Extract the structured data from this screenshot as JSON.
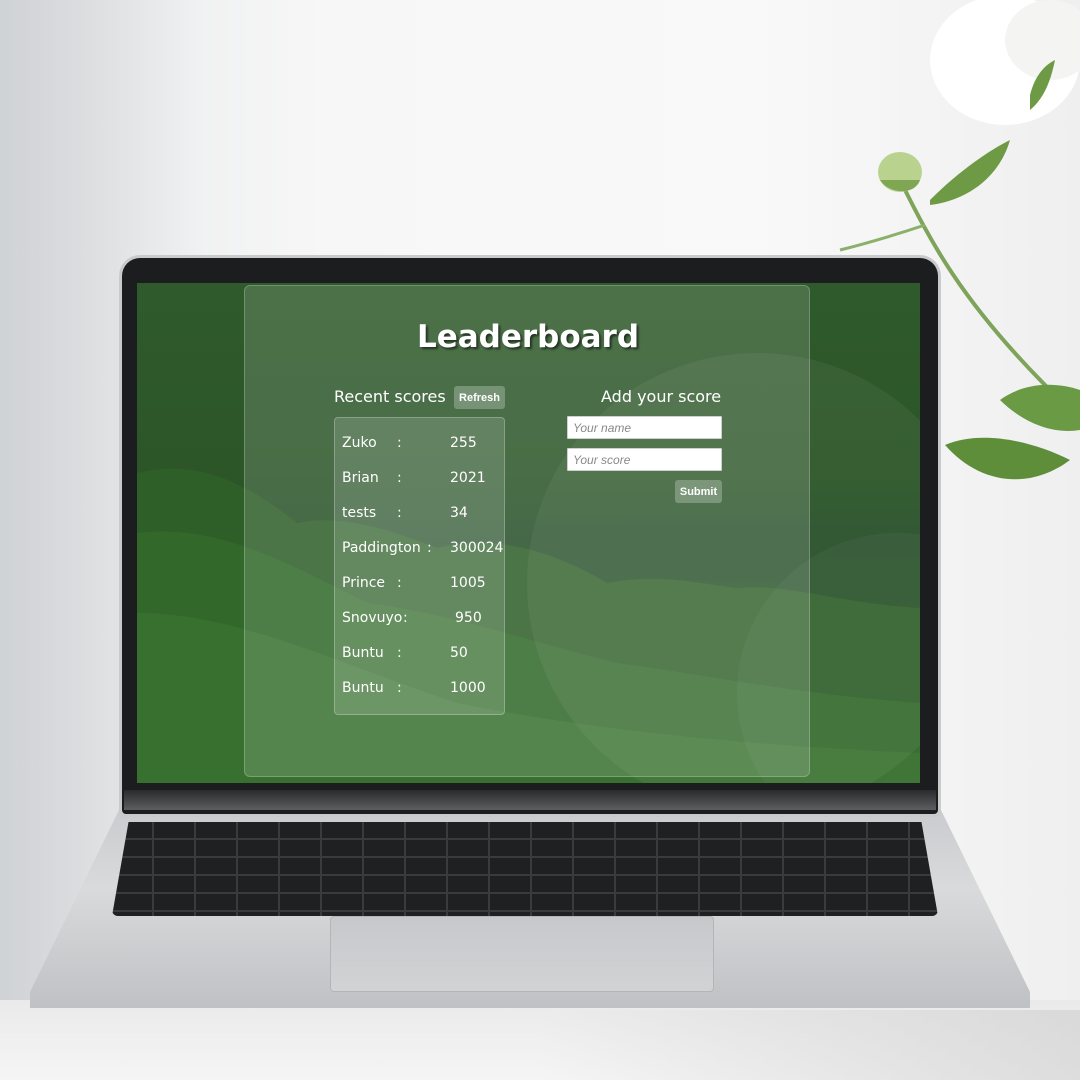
{
  "app": {
    "title": "Leaderboard"
  },
  "recent": {
    "heading": "Recent scores",
    "refresh_label": "Refresh",
    "separator": ":",
    "scores": [
      {
        "name": "Zuko",
        "score": "255"
      },
      {
        "name": "Brian",
        "score": "2021"
      },
      {
        "name": "tests",
        "score": "34"
      },
      {
        "name": "Paddington",
        "score": "300024"
      },
      {
        "name": "Prince",
        "score": "1005"
      },
      {
        "name": "Snovuyo",
        "score": "950"
      },
      {
        "name": "Buntu",
        "score": "50"
      },
      {
        "name": "Buntu",
        "score": "1000"
      }
    ]
  },
  "add": {
    "heading": "Add your score",
    "name_placeholder": "Your name",
    "score_placeholder": "Your score",
    "submit_label": "Submit"
  },
  "colors": {
    "screen_green": "#2c5628",
    "panel_glass": "rgba(255,255,255,0.14)",
    "text": "#ffffff"
  }
}
